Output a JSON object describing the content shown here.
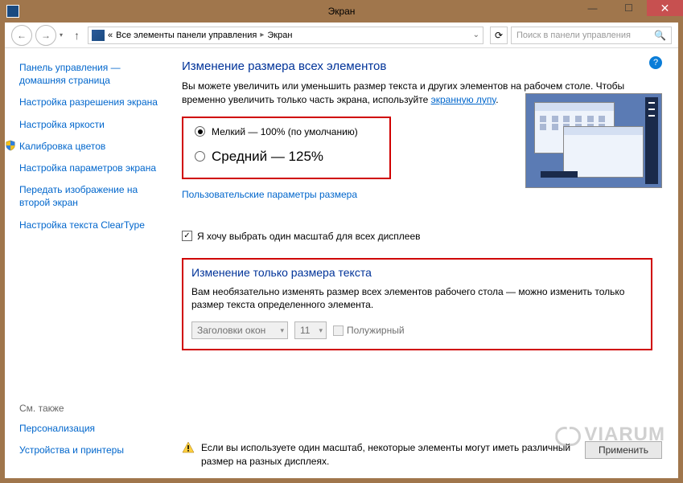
{
  "titlebar": {
    "title": "Экран"
  },
  "nav": {
    "breadcrumb_prefix": "«",
    "breadcrumb1": "Все элементы панели управления",
    "breadcrumb2": "Экран",
    "search_placeholder": "Поиск в панели управления"
  },
  "sidebar": {
    "links": [
      "Панель управления — домашняя страница",
      "Настройка разрешения экрана",
      "Настройка яркости",
      "Калибровка цветов",
      "Настройка параметров экрана",
      "Передать изображение на второй экран",
      "Настройка текста ClearType"
    ],
    "see_also_heading": "См. также",
    "see_also": [
      "Персонализация",
      "Устройства и принтеры"
    ]
  },
  "main": {
    "heading1": "Изменение размера всех элементов",
    "desc1_a": "Вы можете увеличить или уменьшить размер текста и других элементов на рабочем столе. Чтобы временно увеличить только часть экрана, используйте ",
    "desc1_link": "экранную лупу",
    "desc1_b": ".",
    "radio_small": "Мелкий — 100% (по умолчанию)",
    "radio_medium": "Средний — 125%",
    "custom_link": "Пользовательские параметры размера",
    "checkbox_single_scale": "Я хочу выбрать один масштаб для всех дисплеев",
    "heading2": "Изменение только размера текста",
    "desc2": "Вам необязательно изменять размер всех элементов рабочего стола — можно изменить только размер текста определенного элемента.",
    "dd_titles": "Заголовки окон",
    "dd_size": "11",
    "bold_label": "Полужирный",
    "warn_text": "Если вы используете один масштаб, некоторые элементы могут иметь различный размер на разных дисплеях.",
    "apply_label": "Применить"
  },
  "watermark": "VIARUM"
}
